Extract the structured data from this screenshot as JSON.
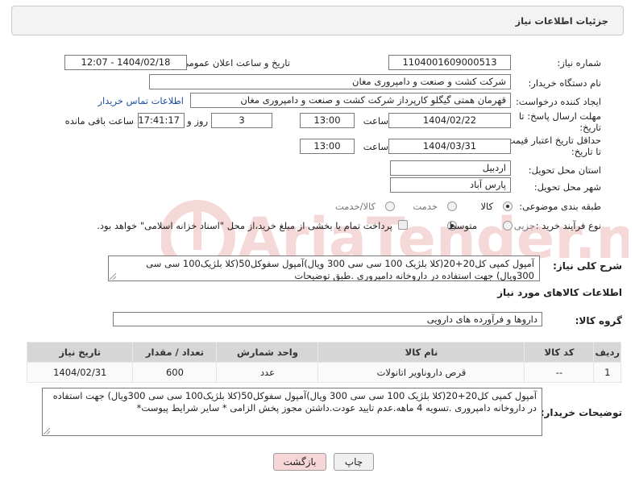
{
  "header": {
    "title": "جزئیات اطلاعات نیاز"
  },
  "form": {
    "need_number": {
      "label": "شماره نیاز:",
      "value": "1104001609000513"
    },
    "announce_datetime": {
      "label": "تاریخ و ساعت اعلان عمومی:",
      "value": "1404/02/18 - 12:07"
    },
    "buyer_org": {
      "label": "نام دستگاه خریدار:",
      "value": "شرکت کشت و صنعت و دامپروری مغان"
    },
    "requester": {
      "label": "ایجاد کننده درخواست:",
      "value": "قهرمان همتی گیگلو کارپرداز شرکت کشت و صنعت و دامپروری مغان",
      "contact_link": "اطلاعات تماس خریدار"
    },
    "reply_deadline": {
      "label_line1": "مهلت ارسال پاسخ: تا",
      "label_line2": "تاریخ:",
      "date": "1404/02/22",
      "time_label": "ساعت",
      "time": "13:00",
      "days": "3",
      "days_label": "روز و",
      "remaining": "17:41:17",
      "remaining_label": "ساعت باقی مانده"
    },
    "price_validity": {
      "label_line1": "حداقل تاریخ اعتبار قیمت:",
      "label_line2": "تا تاریخ:",
      "date": "1404/03/31",
      "time_label": "ساعت",
      "time": "13:00"
    },
    "province": {
      "label": "استان محل تحویل:",
      "value": "اردبیل"
    },
    "city": {
      "label": "شهر محل تحویل:",
      "value": "پارس آباد"
    },
    "category": {
      "label": "طبقه بندی موضوعی:",
      "options": [
        "کالا",
        "خدمت",
        "کالا/خدمت"
      ],
      "selected": "کالا"
    },
    "purchase_type": {
      "label": "نوع فرآیند خرید :",
      "options": [
        "جزیی",
        "متوسط"
      ],
      "selected": "متوسط",
      "note": "پرداخت تمام یا بخشی از مبلغ خرید،از محل \"اسناد خزانه اسلامی\" خواهد بود."
    },
    "description": {
      "label": "شرح کلی نیاز:",
      "value": "آمپول کمپی کل20+20(کلا بلژیک 100 سی سی 300 ویال)آمپول سفوکل50(کلا بلژیک100 سی سی 300ویال) جهت استفاده در داروخانه دامپروری .طبق توضیحات"
    }
  },
  "items_section": {
    "title": "اطلاعات کالاهای مورد نیاز",
    "group_label": "گروه کالا:",
    "group_value": "داروها و فرآورده های دارویی",
    "columns": [
      "ردیف",
      "کد کالا",
      "نام کالا",
      "واحد شمارش",
      "تعداد / مقدار",
      "تاریخ نیاز"
    ],
    "rows": [
      {
        "row": "1",
        "code": "--",
        "name": "قرص داروناویر اتانولات",
        "unit": "عدد",
        "qty": "600",
        "date": "1404/02/31"
      }
    ]
  },
  "buyer_notes": {
    "label": "توضیحات خریدار:",
    "value": "آمپول کمپی کل20+20(کلا بلژیک 100 سی سی 300 ویال)آمپول سفوکل50(کلا بلژیک100 سی سی 300ویال) جهت استفاده در داروخانه دامپروری .تسویه 4 ماهه.عدم تایید عودت.داشتن مجوز پخش الزامی * سایر شرایط پیوست*"
  },
  "buttons": {
    "print": "چاپ",
    "back": "بازگشت"
  },
  "watermark": {
    "brand": "AriaTender.net"
  },
  "colors": {
    "link": "#1a4fa0",
    "back_button": "#f6d6d6",
    "table_header": "#d6d6d6"
  }
}
